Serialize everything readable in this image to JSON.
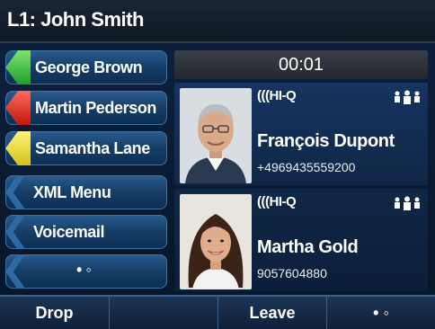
{
  "title": "L1: John Smith",
  "line_keys": [
    {
      "label": "George Brown",
      "status_color": "#2fb53a"
    },
    {
      "label": "Martin Pederson",
      "status_color": "#e0261a"
    },
    {
      "label": "Samantha Lane",
      "status_color": "#f0df34"
    },
    {
      "label": "XML Menu"
    },
    {
      "label": "Voicemail"
    },
    {
      "label": "• ◦"
    }
  ],
  "timer": "00:01",
  "calls": [
    {
      "hd": "(((HI-Q",
      "name": "François Dupont",
      "number": "+4969435559200"
    },
    {
      "hd": "(((HI-Q",
      "name": "Martha Gold",
      "number": "9057604880"
    }
  ],
  "soft_keys": [
    {
      "label": "Drop"
    },
    {
      "label": ""
    },
    {
      "label": "Leave"
    },
    {
      "label": "• ◦"
    }
  ]
}
